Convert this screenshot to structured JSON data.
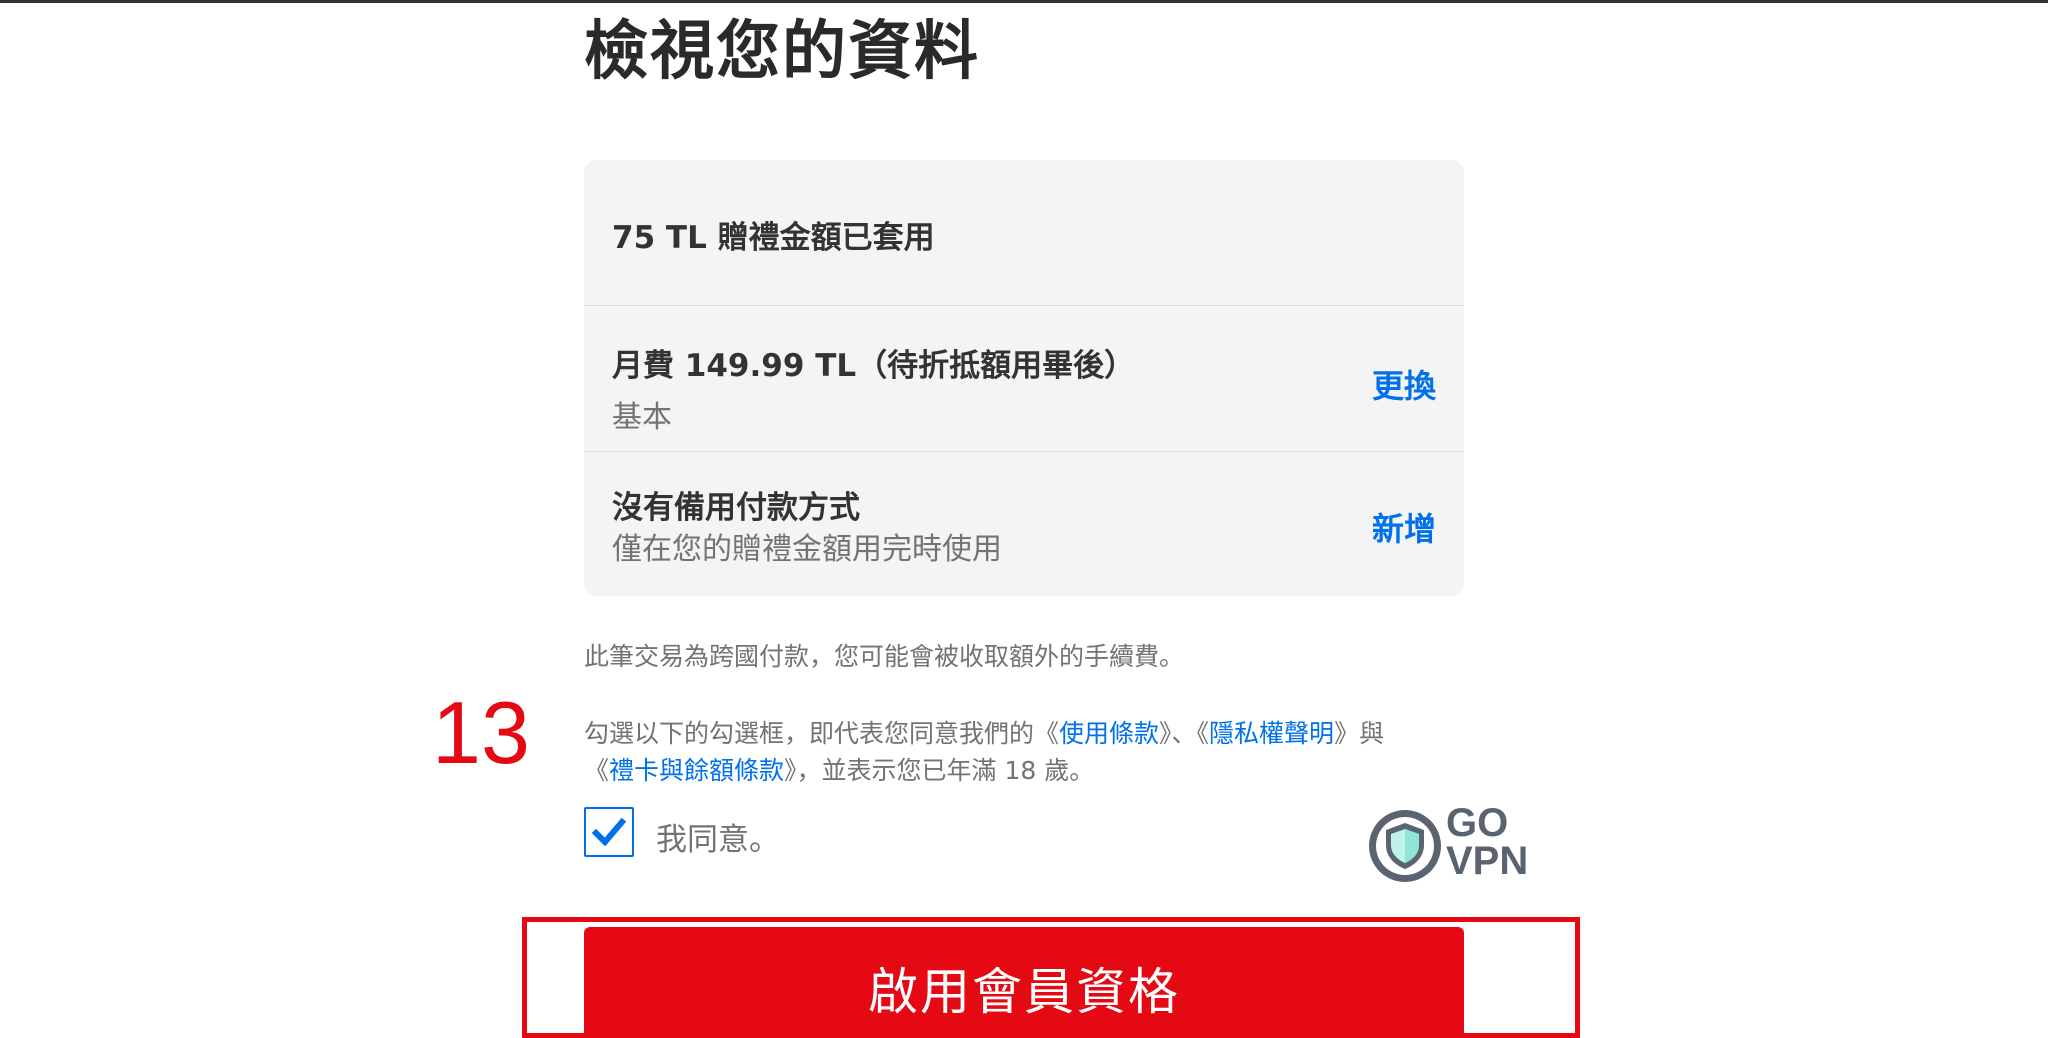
{
  "page": {
    "title": "檢視您的資料"
  },
  "summary": {
    "credit_applied": "75 TL 贈禮金額已套用",
    "plan": {
      "price": "月費 149.99 TL（待折抵額用畢後）",
      "name": "基本",
      "change_label": "更換"
    },
    "payment": {
      "title": "沒有備用付款方式",
      "subtitle": "僅在您的贈禮金額用完時使用",
      "add_label": "新增"
    }
  },
  "fee_note": "此筆交易為跨國付款，您可能會被收取額外的手續費。",
  "annotation": {
    "step_number": "13"
  },
  "terms": {
    "line1_prefix": "勾選以下的勾選框，即代表您同意我們的《",
    "terms_of_use": "使用條款",
    "separator": "》、《",
    "privacy": "隱私權聲明",
    "line1_suffix": "》與",
    "line2_prefix": "《",
    "gift_terms": "禮卡與餘額條款",
    "line2_suffix": "》，並表示您已年滿 18 歲。"
  },
  "agree": {
    "checked": true,
    "label": "我同意。"
  },
  "logo": {
    "line1": "GO",
    "line2": "VPN"
  },
  "cta": {
    "label": "啟用會員資格"
  },
  "colors": {
    "accent_red": "#e50914",
    "link_blue": "#0071eb",
    "card_bg": "#f4f4f4",
    "muted_text": "#737373"
  },
  "icons": {
    "checkbox": "checkmark-icon",
    "logo": "shield-icon"
  }
}
